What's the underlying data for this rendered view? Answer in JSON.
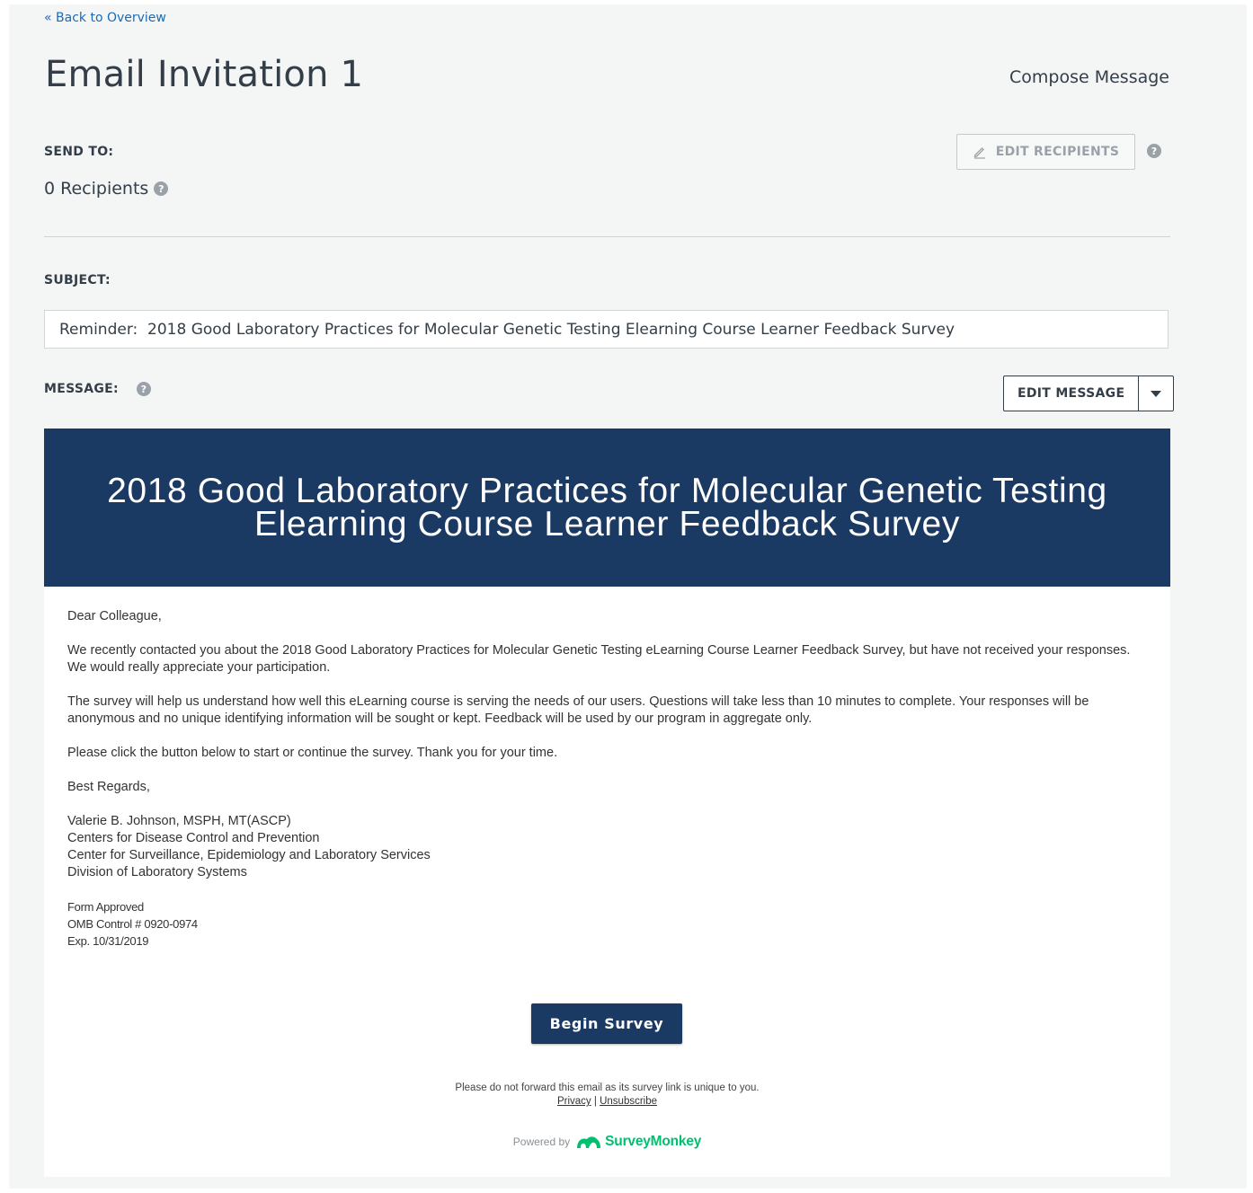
{
  "nav": {
    "back_label": "« Back to Overview"
  },
  "header": {
    "title": "Email Invitation 1",
    "step_label": "Compose Message"
  },
  "send_to": {
    "label": "SEND TO:",
    "recipients_text": "0 Recipients",
    "edit_button_label": "EDIT RECIPIENTS"
  },
  "subject": {
    "label": "SUBJECT:",
    "value": "Reminder:  2018 Good Laboratory Practices for Molecular Genetic Testing Elearning Course Learner Feedback Survey"
  },
  "message": {
    "label": "MESSAGE:",
    "edit_button_label": "EDIT MESSAGE"
  },
  "email": {
    "banner_title": "2018 Good Laboratory Practices for Molecular Genetic Testing Elearning Course Learner Feedback Survey",
    "greeting": "Dear Colleague,",
    "paragraph_1": "We recently contacted you about the 2018 Good Laboratory Practices for Molecular Genetic Testing eLearning Course Learner Feedback Survey, but have not received your responses. We would really appreciate your participation.",
    "paragraph_2": "The survey will help us understand how well this eLearning course is serving the needs of our users. Questions will take less than 10 minutes to complete. Your responses will be anonymous and no unique identifying information will be sought or kept. Feedback will be used by our program in aggregate only.",
    "paragraph_3": "Please click the button below to start or continue the survey. Thank you for your time.",
    "closing": "Best Regards,",
    "signature": [
      "Valerie B. Johnson, MSPH, MT(ASCP)",
      "Centers for Disease Control and Prevention",
      "Center for Surveillance, Epidemiology and Laboratory Services",
      "Division of Laboratory Systems"
    ],
    "form_info": [
      "Form Approved",
      "OMB Control # 0920-0974",
      "Exp. 10/31/2019"
    ],
    "cta_label": "Begin Survey",
    "footer_note": "Please do not forward this email as its survey link is unique to you.",
    "privacy_label": "Privacy",
    "separator": "|",
    "unsubscribe_label": "Unsubscribe",
    "powered_by_label": "Powered by",
    "brand_name": "SurveyMonkey"
  },
  "icons": {
    "help": "question-circle-icon",
    "edit": "pencil-icon",
    "caret": "caret-down-icon",
    "logo": "surveymonkey-logo-icon"
  },
  "colors": {
    "link": "#1b6ab5",
    "banner": "#1a3a64",
    "brand_green": "#00bf6f",
    "page_bg": "#f4f5f5"
  }
}
